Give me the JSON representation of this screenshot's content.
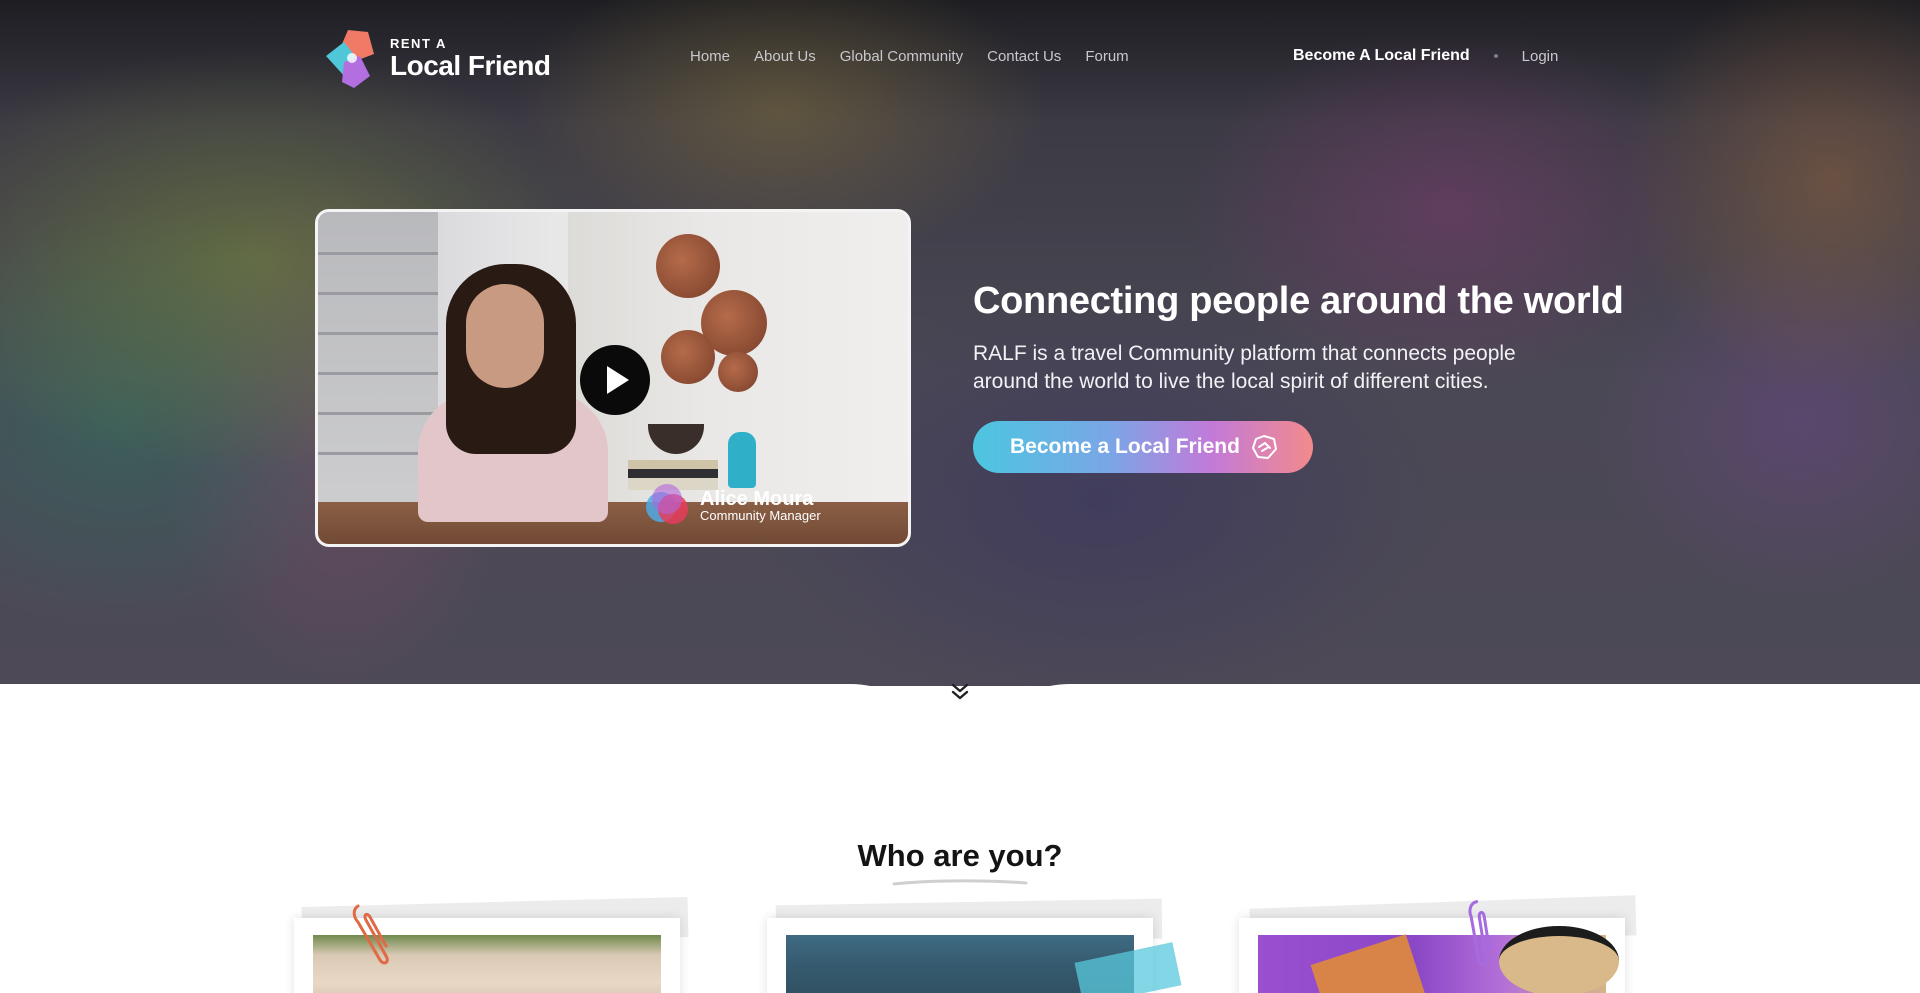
{
  "brand": {
    "logo_small": "RENT A",
    "logo_big": "Local Friend"
  },
  "nav": {
    "items": [
      "Home",
      "About Us",
      "Global Community",
      "Contact Us",
      "Forum"
    ],
    "become_label": "Become A Local Friend",
    "login_label": "Login"
  },
  "video": {
    "speaker_name": "Alice Moura",
    "speaker_role": "Community Manager"
  },
  "hero": {
    "title": "Connecting people around the world",
    "description": "RALF is a travel Community platform that connects people around the world to live the local spirit of different cities.",
    "cta_label": "Become a Local Friend"
  },
  "section": {
    "title": "Who are you?"
  },
  "icons": {
    "scroll": "double-chevron-down-icon",
    "play": "play-icon",
    "cta": "friend-hands-icon"
  },
  "colors": {
    "cta_start": "#4cc6e0",
    "cta_end": "#f28a8c",
    "hero_bg": "#4a4854"
  }
}
